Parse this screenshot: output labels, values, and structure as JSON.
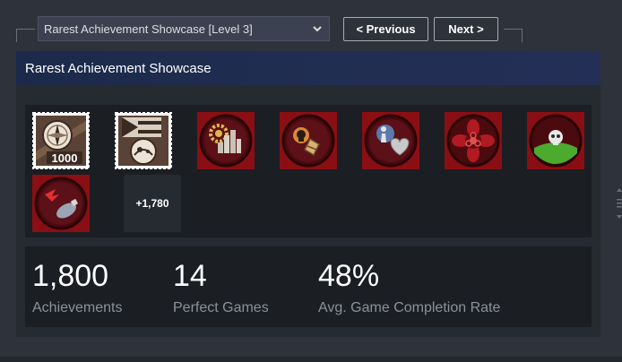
{
  "toolbar": {
    "showcase_select": "Rarest Achievement Showcase [Level 3]",
    "previous_label": "< Previous",
    "next_label": "Next >"
  },
  "panel": {
    "title": "Rarest Achievement Showcase",
    "achievements": [
      {
        "icon": "compass-1000-badge-icon"
      },
      {
        "icon": "flag-planet-badge-icon"
      },
      {
        "icon": "gear-city-badge-icon"
      },
      {
        "icon": "skull-shield-badge-icon"
      },
      {
        "icon": "chess-heart-badge-icon"
      },
      {
        "icon": "biohazard-flower-badge-icon"
      },
      {
        "icon": "skull-hill-badge-icon"
      },
      {
        "icon": "bird-bomb-badge-icon"
      }
    ],
    "more_count": "+1,780"
  },
  "stats": [
    {
      "value": "1,800",
      "label": "Achievements"
    },
    {
      "value": "14",
      "label": "Perfect Games"
    },
    {
      "value": "48%",
      "label": "Avg. Game Completion Rate"
    }
  ],
  "colors": {
    "page_bg": "#2e323a",
    "panel_bg": "#262a31",
    "header_blue": "#212e52",
    "badge_red": "#8a0f14",
    "muted_text": "#8b929a"
  }
}
